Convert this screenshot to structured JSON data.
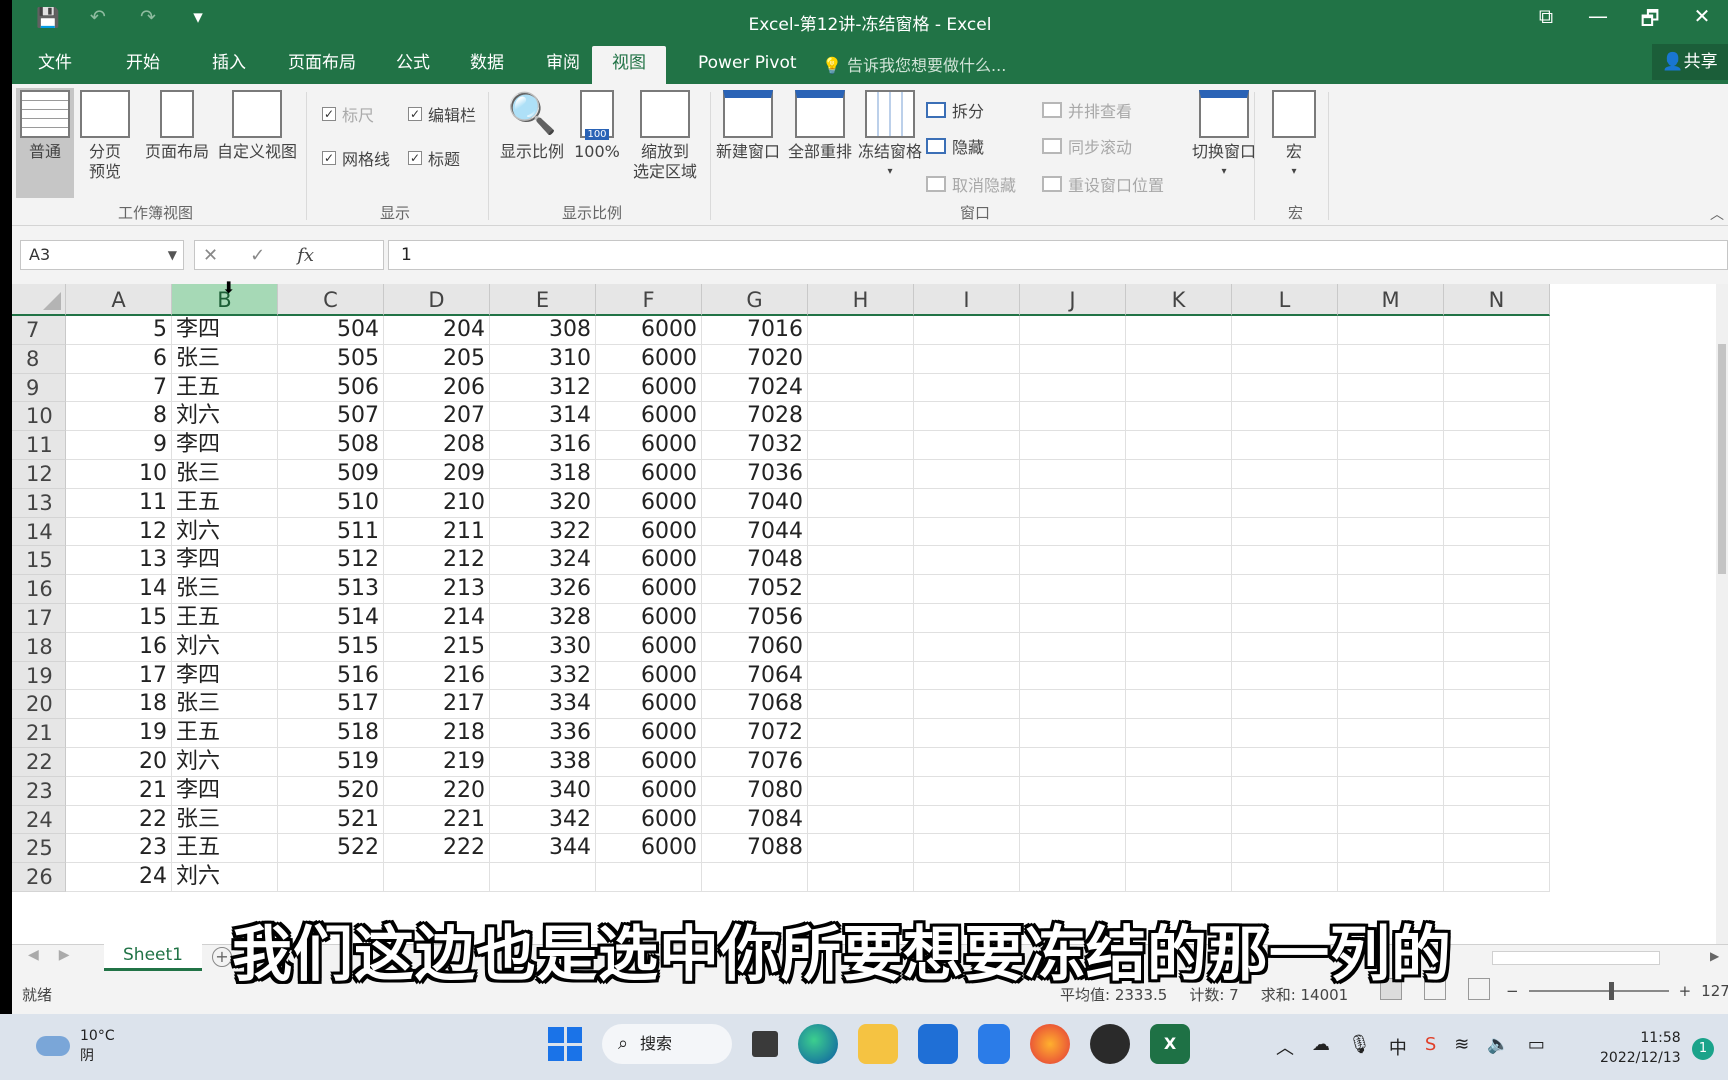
{
  "window": {
    "title": "Excel-第12讲-冻结窗格 - Excel",
    "qat": [
      "💾",
      "↶",
      "↷",
      "▾"
    ],
    "controls": [
      "⧉",
      "—",
      "🗗",
      "✕"
    ]
  },
  "tabs": [
    "文件",
    "开始",
    "插入",
    "页面布局",
    "公式",
    "数据",
    "审阅",
    "视图",
    "Power Pivot"
  ],
  "active_tab": "视图",
  "tell_me": "告诉我您想要做什么...",
  "share": "共享",
  "ribbon": {
    "workbook_views": {
      "label": "工作簿视图",
      "buttons": [
        "普通",
        "分页\n预览",
        "页面布局",
        "自定义视图"
      ]
    },
    "show": {
      "label": "显示",
      "ruler": "标尺",
      "formula_bar": "编辑栏",
      "gridlines": "网格线",
      "headings": "标题"
    },
    "zoom": {
      "label": "显示比例",
      "zoom_btn": "显示比例",
      "hundred": "100%",
      "hundred_badge": "100",
      "zoom_sel": "缩放到\n选定区域"
    },
    "window": {
      "label": "窗口",
      "new_window": "新建窗口",
      "arrange_all": "全部重排",
      "freeze_panes": "冻结窗格",
      "split": "拆分",
      "hide": "隐藏",
      "unhide": "取消隐藏",
      "side_by_side": "并排查看",
      "sync_scroll": "同步滚动",
      "reset_position": "重设窗口位置",
      "switch_windows": "切换窗口"
    },
    "macros": {
      "label": "宏",
      "button": "宏"
    }
  },
  "formula_bar": {
    "name_box": "A3",
    "cancel": "✕",
    "enter": "✓",
    "fx": "fx",
    "value": "1"
  },
  "columns": [
    "A",
    "B",
    "C",
    "D",
    "E",
    "F",
    "G",
    "H",
    "I",
    "J",
    "K",
    "L",
    "M",
    "N"
  ],
  "selected_column": "B",
  "rows": [
    {
      "n": "7",
      "cells": [
        "5",
        "李四",
        "504",
        "204",
        "308",
        "6000",
        "7016"
      ]
    },
    {
      "n": "8",
      "cells": [
        "6",
        "张三",
        "505",
        "205",
        "310",
        "6000",
        "7020"
      ]
    },
    {
      "n": "9",
      "cells": [
        "7",
        "王五",
        "506",
        "206",
        "312",
        "6000",
        "7024"
      ]
    },
    {
      "n": "10",
      "cells": [
        "8",
        "刘六",
        "507",
        "207",
        "314",
        "6000",
        "7028"
      ]
    },
    {
      "n": "11",
      "cells": [
        "9",
        "李四",
        "508",
        "208",
        "316",
        "6000",
        "7032"
      ]
    },
    {
      "n": "12",
      "cells": [
        "10",
        "张三",
        "509",
        "209",
        "318",
        "6000",
        "7036"
      ]
    },
    {
      "n": "13",
      "cells": [
        "11",
        "王五",
        "510",
        "210",
        "320",
        "6000",
        "7040"
      ]
    },
    {
      "n": "14",
      "cells": [
        "12",
        "刘六",
        "511",
        "211",
        "322",
        "6000",
        "7044"
      ]
    },
    {
      "n": "15",
      "cells": [
        "13",
        "李四",
        "512",
        "212",
        "324",
        "6000",
        "7048"
      ]
    },
    {
      "n": "16",
      "cells": [
        "14",
        "张三",
        "513",
        "213",
        "326",
        "6000",
        "7052"
      ]
    },
    {
      "n": "17",
      "cells": [
        "15",
        "王五",
        "514",
        "214",
        "328",
        "6000",
        "7056"
      ]
    },
    {
      "n": "18",
      "cells": [
        "16",
        "刘六",
        "515",
        "215",
        "330",
        "6000",
        "7060"
      ]
    },
    {
      "n": "19",
      "cells": [
        "17",
        "李四",
        "516",
        "216",
        "332",
        "6000",
        "7064"
      ]
    },
    {
      "n": "20",
      "cells": [
        "18",
        "张三",
        "517",
        "217",
        "334",
        "6000",
        "7068"
      ]
    },
    {
      "n": "21",
      "cells": [
        "19",
        "王五",
        "518",
        "218",
        "336",
        "6000",
        "7072"
      ]
    },
    {
      "n": "22",
      "cells": [
        "20",
        "刘六",
        "519",
        "219",
        "338",
        "6000",
        "7076"
      ]
    },
    {
      "n": "23",
      "cells": [
        "21",
        "李四",
        "520",
        "220",
        "340",
        "6000",
        "7080"
      ]
    },
    {
      "n": "24",
      "cells": [
        "22",
        "张三",
        "521",
        "221",
        "342",
        "6000",
        "7084"
      ]
    },
    {
      "n": "25",
      "cells": [
        "23",
        "王五",
        "522",
        "222",
        "344",
        "6000",
        "7088"
      ]
    },
    {
      "n": "26",
      "cells": [
        "24",
        "刘六",
        "",
        "",
        "",
        "",
        ""
      ]
    }
  ],
  "sheet_tab": "Sheet1",
  "status": {
    "ready": "就绪",
    "average": "平均值: 2333.5",
    "count": "计数: 7",
    "sum": "求和: 14001",
    "zoom": "127%"
  },
  "taskbar": {
    "temp": "10°C",
    "weather": "阴",
    "search": "搜索",
    "time": "11:58",
    "date": "2022/12/13",
    "notifications": "1"
  },
  "subtitle": "我们这边也是选中你所要想要冻结的那一列的",
  "colors": {
    "excel_green": "#217346",
    "selected_header": "#a6d9b6"
  }
}
